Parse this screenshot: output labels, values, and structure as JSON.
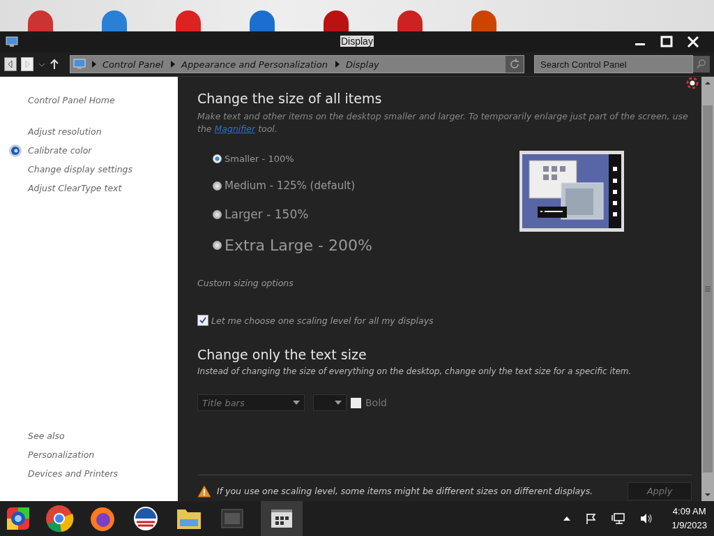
{
  "window": {
    "title": "Display"
  },
  "address_bar": {
    "path": [
      "Control Panel",
      "Appearance and Personalization",
      "Display"
    ]
  },
  "search": {
    "placeholder": "Search Control Panel"
  },
  "sidebar": {
    "home": "Control Panel Home",
    "tasks": [
      {
        "label": "Adjust resolution",
        "kind": "plain"
      },
      {
        "label": "Calibrate color",
        "kind": "icon"
      },
      {
        "label": "Change display settings",
        "kind": "plain"
      },
      {
        "label": "Adjust ClearType text",
        "kind": "plain"
      }
    ],
    "see_also": {
      "heading": "See also",
      "links": [
        "Personalization",
        "Devices and Printers"
      ]
    }
  },
  "main": {
    "heading": "Change the size of all items",
    "description": {
      "text": "Make text and other items on the desktop smaller and larger. To temporarily enlarge just part of the screen, use the",
      "link": "Magnifier",
      "after": "tool."
    },
    "size_options": [
      {
        "label": "Smaller - 100%",
        "selected": true
      },
      {
        "label": "Medium - 125% (default)",
        "selected": false
      },
      {
        "label": "Larger - 150%",
        "selected": false
      },
      {
        "label": "Extra Large - 200%",
        "selected": false
      }
    ],
    "custom_sizing": "Custom sizing options",
    "one_scaling": {
      "label": "Let me choose one scaling level for all my displays",
      "checked": true
    },
    "text_size": {
      "heading": "Change only the text size",
      "description": "Instead of changing the size of everything on the desktop, change only the text size for a specific item.",
      "item": "Title bars",
      "bold": {
        "label": "Bold",
        "checked": false
      }
    },
    "warning": "If you use one scaling level, some items might be different sizes on different displays.",
    "apply": "Apply"
  },
  "taskbar": {
    "time": "4:09 AM",
    "date": "1/9/2023"
  }
}
